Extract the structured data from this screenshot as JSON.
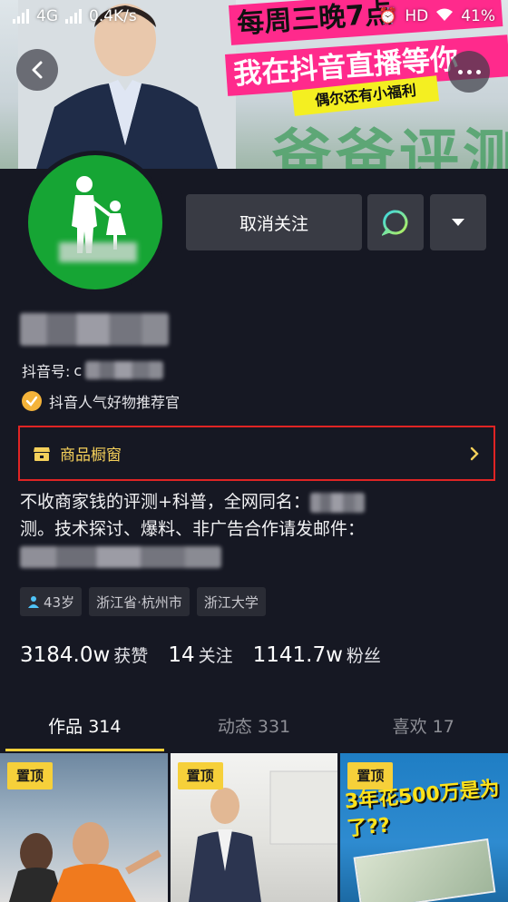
{
  "status_bar": {
    "left": "4G",
    "speed": "0.4K/s",
    "hd": "HD",
    "battery": "41%"
  },
  "banner": {
    "promo_line1": "每周三晚7点",
    "promo_line2": "我在抖音直播等你",
    "promo_line3": "偶尔还有小福利",
    "bg_word": "爸爸评测"
  },
  "profile": {
    "follow_button": "取消关注",
    "douyin_id_label": "抖音号: ",
    "douyin_id_prefix": "c",
    "certification": "抖音人气好物推荐官",
    "showcase_label": "商品橱窗",
    "bio_line1": "不收商家钱的评测+科普，全网同名：",
    "bio_line2": "测。技术探讨、爆料、非广告合作请发邮件：",
    "tags": {
      "age": "43岁",
      "location": "浙江省·杭州市",
      "school": "浙江大学"
    }
  },
  "stats": {
    "likes_num": "3184.0w",
    "likes_label": "获赞",
    "following_num": "14",
    "following_label": "关注",
    "followers_num": "1141.7w",
    "followers_label": "粉丝"
  },
  "tabs": [
    {
      "label": "作品 314"
    },
    {
      "label": "动态 331"
    },
    {
      "label": "喜欢 17"
    }
  ],
  "videos": [
    {
      "badge": "置顶"
    },
    {
      "badge": "置顶",
      "caption": ""
    },
    {
      "badge": "置顶",
      "caption": "3年花500万是为了??"
    }
  ],
  "colors": {
    "background": "#161823",
    "accent_yellow": "#f6d03a",
    "highlight_red": "#e02424",
    "avatar_green": "#16a534"
  }
}
